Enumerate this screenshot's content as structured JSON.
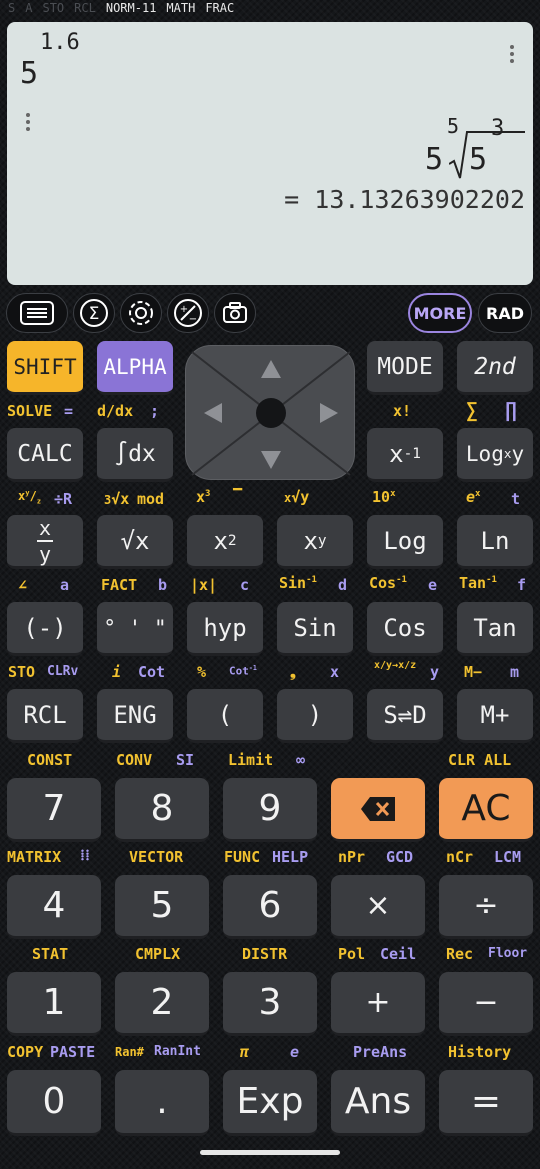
{
  "status": {
    "flags_dim": [
      "S",
      "A",
      "STO",
      "RCL"
    ],
    "flags_on": [
      "NORM-11",
      "MATH",
      "FRAC"
    ]
  },
  "display": {
    "input_base": "5",
    "input_exponent": "1.6",
    "output_coefficient": "5",
    "output_root_index": "5",
    "output_radicand_base": "5",
    "output_radicand_exponent": "3",
    "result": "= 13.13263902202"
  },
  "toolbar": {
    "more": "MORE",
    "angle_mode": "RAD"
  },
  "row1": {
    "shift": "SHIFT",
    "alpha": "ALPHA",
    "mode": "MODE",
    "second": "2nd",
    "shift_shift_label": "SOLVE",
    "shift_alpha_label": "=",
    "alpha_shift_label": "d/dx",
    "alpha_alpha_label": ";",
    "mode_shift_label": "x!",
    "second_shift_label": "∑",
    "second_alpha_label": "∏"
  },
  "row2": {
    "calc": "CALC",
    "int": "∫dx",
    "calc_alpha_label": "÷R",
    "int_shift_label": "mod",
    "x3_label": "x",
    "x3_exp": "3",
    "recip_base": "x",
    "recip_exp": "-1",
    "log_main": "Log",
    "log_sub": "x",
    "log_after": "y",
    "tenx_label": "10",
    "tenx_exp": "x",
    "ex_label": "e",
    "ex_exp": "x",
    "ex_alpha": "t"
  },
  "row3": {
    "frac_num": "x",
    "frac_den": "y",
    "sqrt": "√x",
    "square_base": "x",
    "square_exp": "2",
    "pow_base": "x",
    "pow_exp": "y",
    "log": "Log",
    "ln": "Ln",
    "l_a": "∠",
    "l_a_alpha": "a",
    "l_fact": "FACT",
    "l_fact_alpha": "b",
    "l_abs": "|x|",
    "l_abs_alpha": "c",
    "l_asin": "Sin",
    "l_asin_exp": "-1",
    "l_asin_alpha": "d",
    "l_acos": "Cos",
    "l_acos_exp": "-1",
    "l_acos_alpha": "e",
    "l_atan": "Tan",
    "l_atan_exp": "-1",
    "l_atan_alpha": "f"
  },
  "row4": {
    "neg": "(-)",
    "dms": "° ' \"",
    "hyp": "hyp",
    "sin": "Sin",
    "cos": "Cos",
    "tan": "Tan",
    "l_sto": "STO",
    "l_clrv": "CLRv",
    "l_i": "i",
    "l_cot": "Cot",
    "l_pct": "%",
    "l_cot1": "Cot",
    "l_cot1_exp": "-1",
    "l_comma": "❟",
    "l_x": "x",
    "l_y": "y",
    "l_mminus": "M−",
    "l_m": "m"
  },
  "row5": {
    "rcl": "RCL",
    "eng": "ENG",
    "lparen": "(",
    "rparen": ")",
    "sd": "S⇌D",
    "mplus": "M+"
  },
  "numpad_labels": {
    "const": "CONST",
    "conv": "CONV",
    "si": "SI",
    "limit": "Limit",
    "inf": "∞",
    "clrall": "CLR ALL",
    "matrix": "MATRIX",
    "vector": "VECTOR",
    "func": "FUNC",
    "help": "HELP",
    "npr": "nPr",
    "gcd": "GCD",
    "ncr": "nCr",
    "lcm": "LCM",
    "stat": "STAT",
    "cmplx": "CMPLX",
    "distr": "DISTR",
    "pol": "Pol",
    "ceil": "Ceil",
    "rec": "Rec",
    "floor": "Floor",
    "copy": "COPY",
    "paste": "PASTE",
    "ran": "Ran#",
    "ranint": "RanInt",
    "pi": "π",
    "e": "e",
    "preans": "PreAns",
    "history": "History"
  },
  "numpad": {
    "k7": "7",
    "k8": "8",
    "k9": "9",
    "ac": "AC",
    "k4": "4",
    "k5": "5",
    "k6": "6",
    "mul": "×",
    "div": "÷",
    "k1": "1",
    "k2": "2",
    "k3": "3",
    "plus": "+",
    "minus": "−",
    "k0": "0",
    "dot": ".",
    "exp": "Exp",
    "ans": "Ans",
    "eq": "="
  },
  "colors": {
    "shift": "#f6b52a",
    "alpha": "#8a74d6",
    "accent_orange": "#f29a55",
    "display_bg": "#dbe3e2"
  }
}
